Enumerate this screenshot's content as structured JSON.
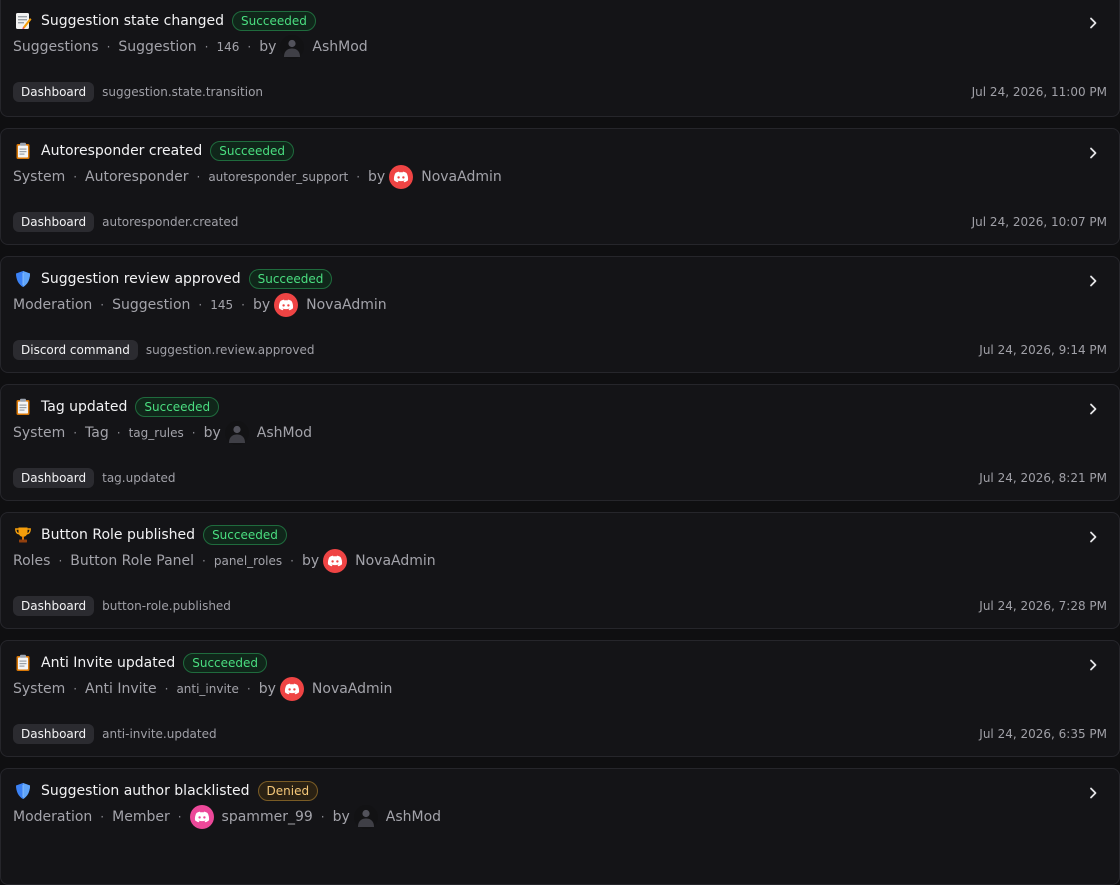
{
  "colors": {
    "success": "#4ade80",
    "denied": "#f5c87a",
    "discord_red": "#ef4444",
    "discord_pink": "#ec4899"
  },
  "events": [
    {
      "icon": "memo-icon",
      "title": "Suggestion state changed",
      "status": "Succeeded",
      "category": "Suggestions",
      "entity": "Suggestion",
      "ref": "146",
      "by_label": "by",
      "actor": "AshMod",
      "actor_avatar": "dark",
      "source": "Dashboard",
      "action": "suggestion.state.transition",
      "time": "Jul 24, 2026, 11:00 PM"
    },
    {
      "icon": "clipboard-icon",
      "title": "Autoresponder created",
      "status": "Succeeded",
      "category": "System",
      "entity": "Autoresponder",
      "ref": "autoresponder_support",
      "by_label": "by",
      "actor": "NovaAdmin",
      "actor_avatar": "discord",
      "source": "Dashboard",
      "action": "autoresponder.created",
      "time": "Jul 24, 2026, 10:07 PM"
    },
    {
      "icon": "shield-icon",
      "title": "Suggestion review approved",
      "status": "Succeeded",
      "category": "Moderation",
      "entity": "Suggestion",
      "ref": "145",
      "by_label": "by",
      "actor": "NovaAdmin",
      "actor_avatar": "discord",
      "source": "Discord command",
      "action": "suggestion.review.approved",
      "time": "Jul 24, 2026, 9:14 PM"
    },
    {
      "icon": "clipboard-icon",
      "title": "Tag updated",
      "status": "Succeeded",
      "category": "System",
      "entity": "Tag",
      "ref": "tag_rules",
      "by_label": "by",
      "actor": "AshMod",
      "actor_avatar": "dark",
      "source": "Dashboard",
      "action": "tag.updated",
      "time": "Jul 24, 2026, 8:21 PM"
    },
    {
      "icon": "trophy-icon",
      "title": "Button Role published",
      "status": "Succeeded",
      "category": "Roles",
      "entity": "Button Role Panel",
      "ref": "panel_roles",
      "by_label": "by",
      "actor": "NovaAdmin",
      "actor_avatar": "discord",
      "source": "Dashboard",
      "action": "button-role.published",
      "time": "Jul 24, 2026, 7:28 PM"
    },
    {
      "icon": "clipboard-icon",
      "title": "Anti Invite updated",
      "status": "Succeeded",
      "category": "System",
      "entity": "Anti Invite",
      "ref": "anti_invite",
      "by_label": "by",
      "actor": "NovaAdmin",
      "actor_avatar": "discord",
      "source": "Dashboard",
      "action": "anti-invite.updated",
      "time": "Jul 24, 2026, 6:35 PM"
    },
    {
      "icon": "shield-icon",
      "title": "Suggestion author blacklisted",
      "status": "Denied",
      "category": "Moderation",
      "entity": "Member",
      "target": "spammer_99",
      "target_avatar": "discord-pink",
      "by_label": "by",
      "actor": "AshMod",
      "actor_avatar": "dark"
    }
  ]
}
